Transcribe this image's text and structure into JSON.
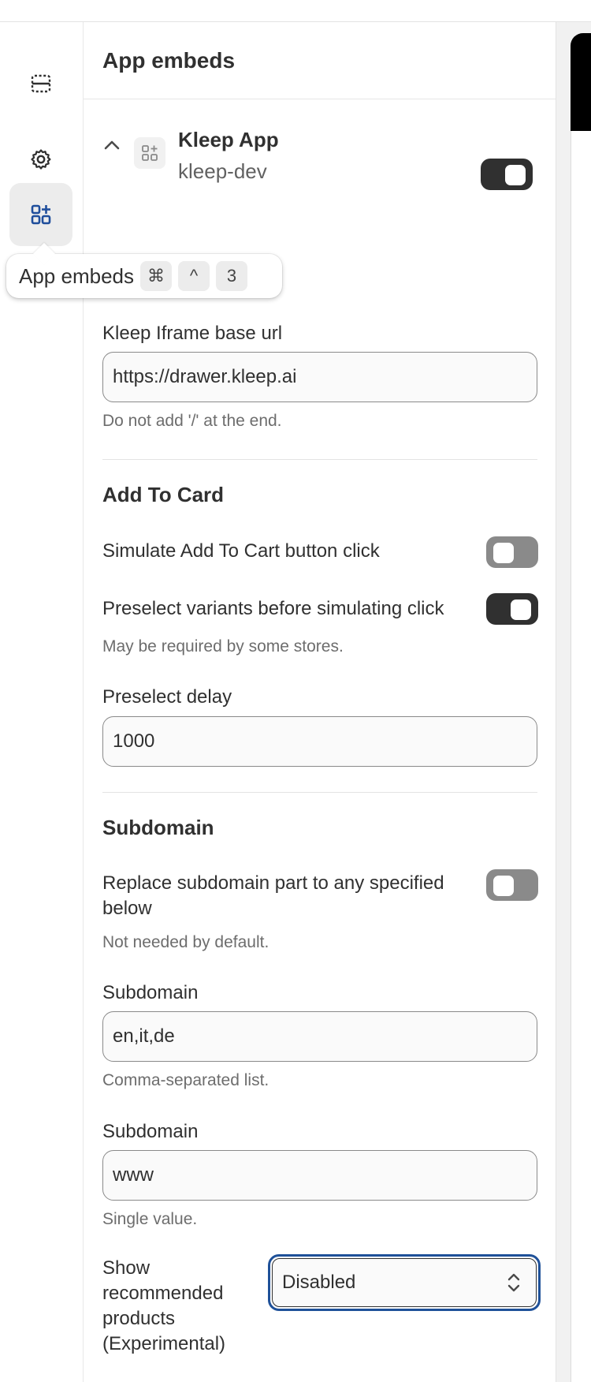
{
  "panel": {
    "title": "App embeds"
  },
  "app": {
    "name": "Kleep App",
    "subtitle": "kleep-dev",
    "enabled": true
  },
  "tooltip": {
    "label": "App embeds",
    "keys": [
      "⌘",
      "^",
      "3"
    ]
  },
  "settings": {
    "iframe_url": {
      "label": "Kleep Iframe base url",
      "value": "https://drawer.kleep.ai",
      "help": "Do not add '/' at the end."
    },
    "add_to_card": {
      "heading": "Add To Card",
      "simulate_label": "Simulate Add To Cart button click",
      "simulate_enabled": false,
      "preselect_label": "Preselect variants before simulating click",
      "preselect_enabled": true,
      "preselect_help": "May be required by some stores.",
      "delay_label": "Preselect delay",
      "delay_value": "1000"
    },
    "subdomain": {
      "heading": "Subdomain",
      "replace_label_line1": "Replace subdomain part to any specified",
      "replace_label_line2": "below",
      "replace_enabled": false,
      "replace_help": "Not needed by default.",
      "list_label": "Subdomain",
      "list_value": "en,it,de",
      "list_help": "Comma-separated list.",
      "single_label": "Subdomain",
      "single_value": "www",
      "single_help": "Single value."
    },
    "recommended": {
      "label_lines": [
        "Show",
        "recommended",
        "products",
        "(Experimental)"
      ],
      "selected": "Disabled"
    }
  },
  "colors": {
    "toggle_on": "#303030",
    "toggle_off": "#8a8a8a",
    "focus_ring": "#1f5199",
    "active_icon": "#1f4e9c"
  }
}
